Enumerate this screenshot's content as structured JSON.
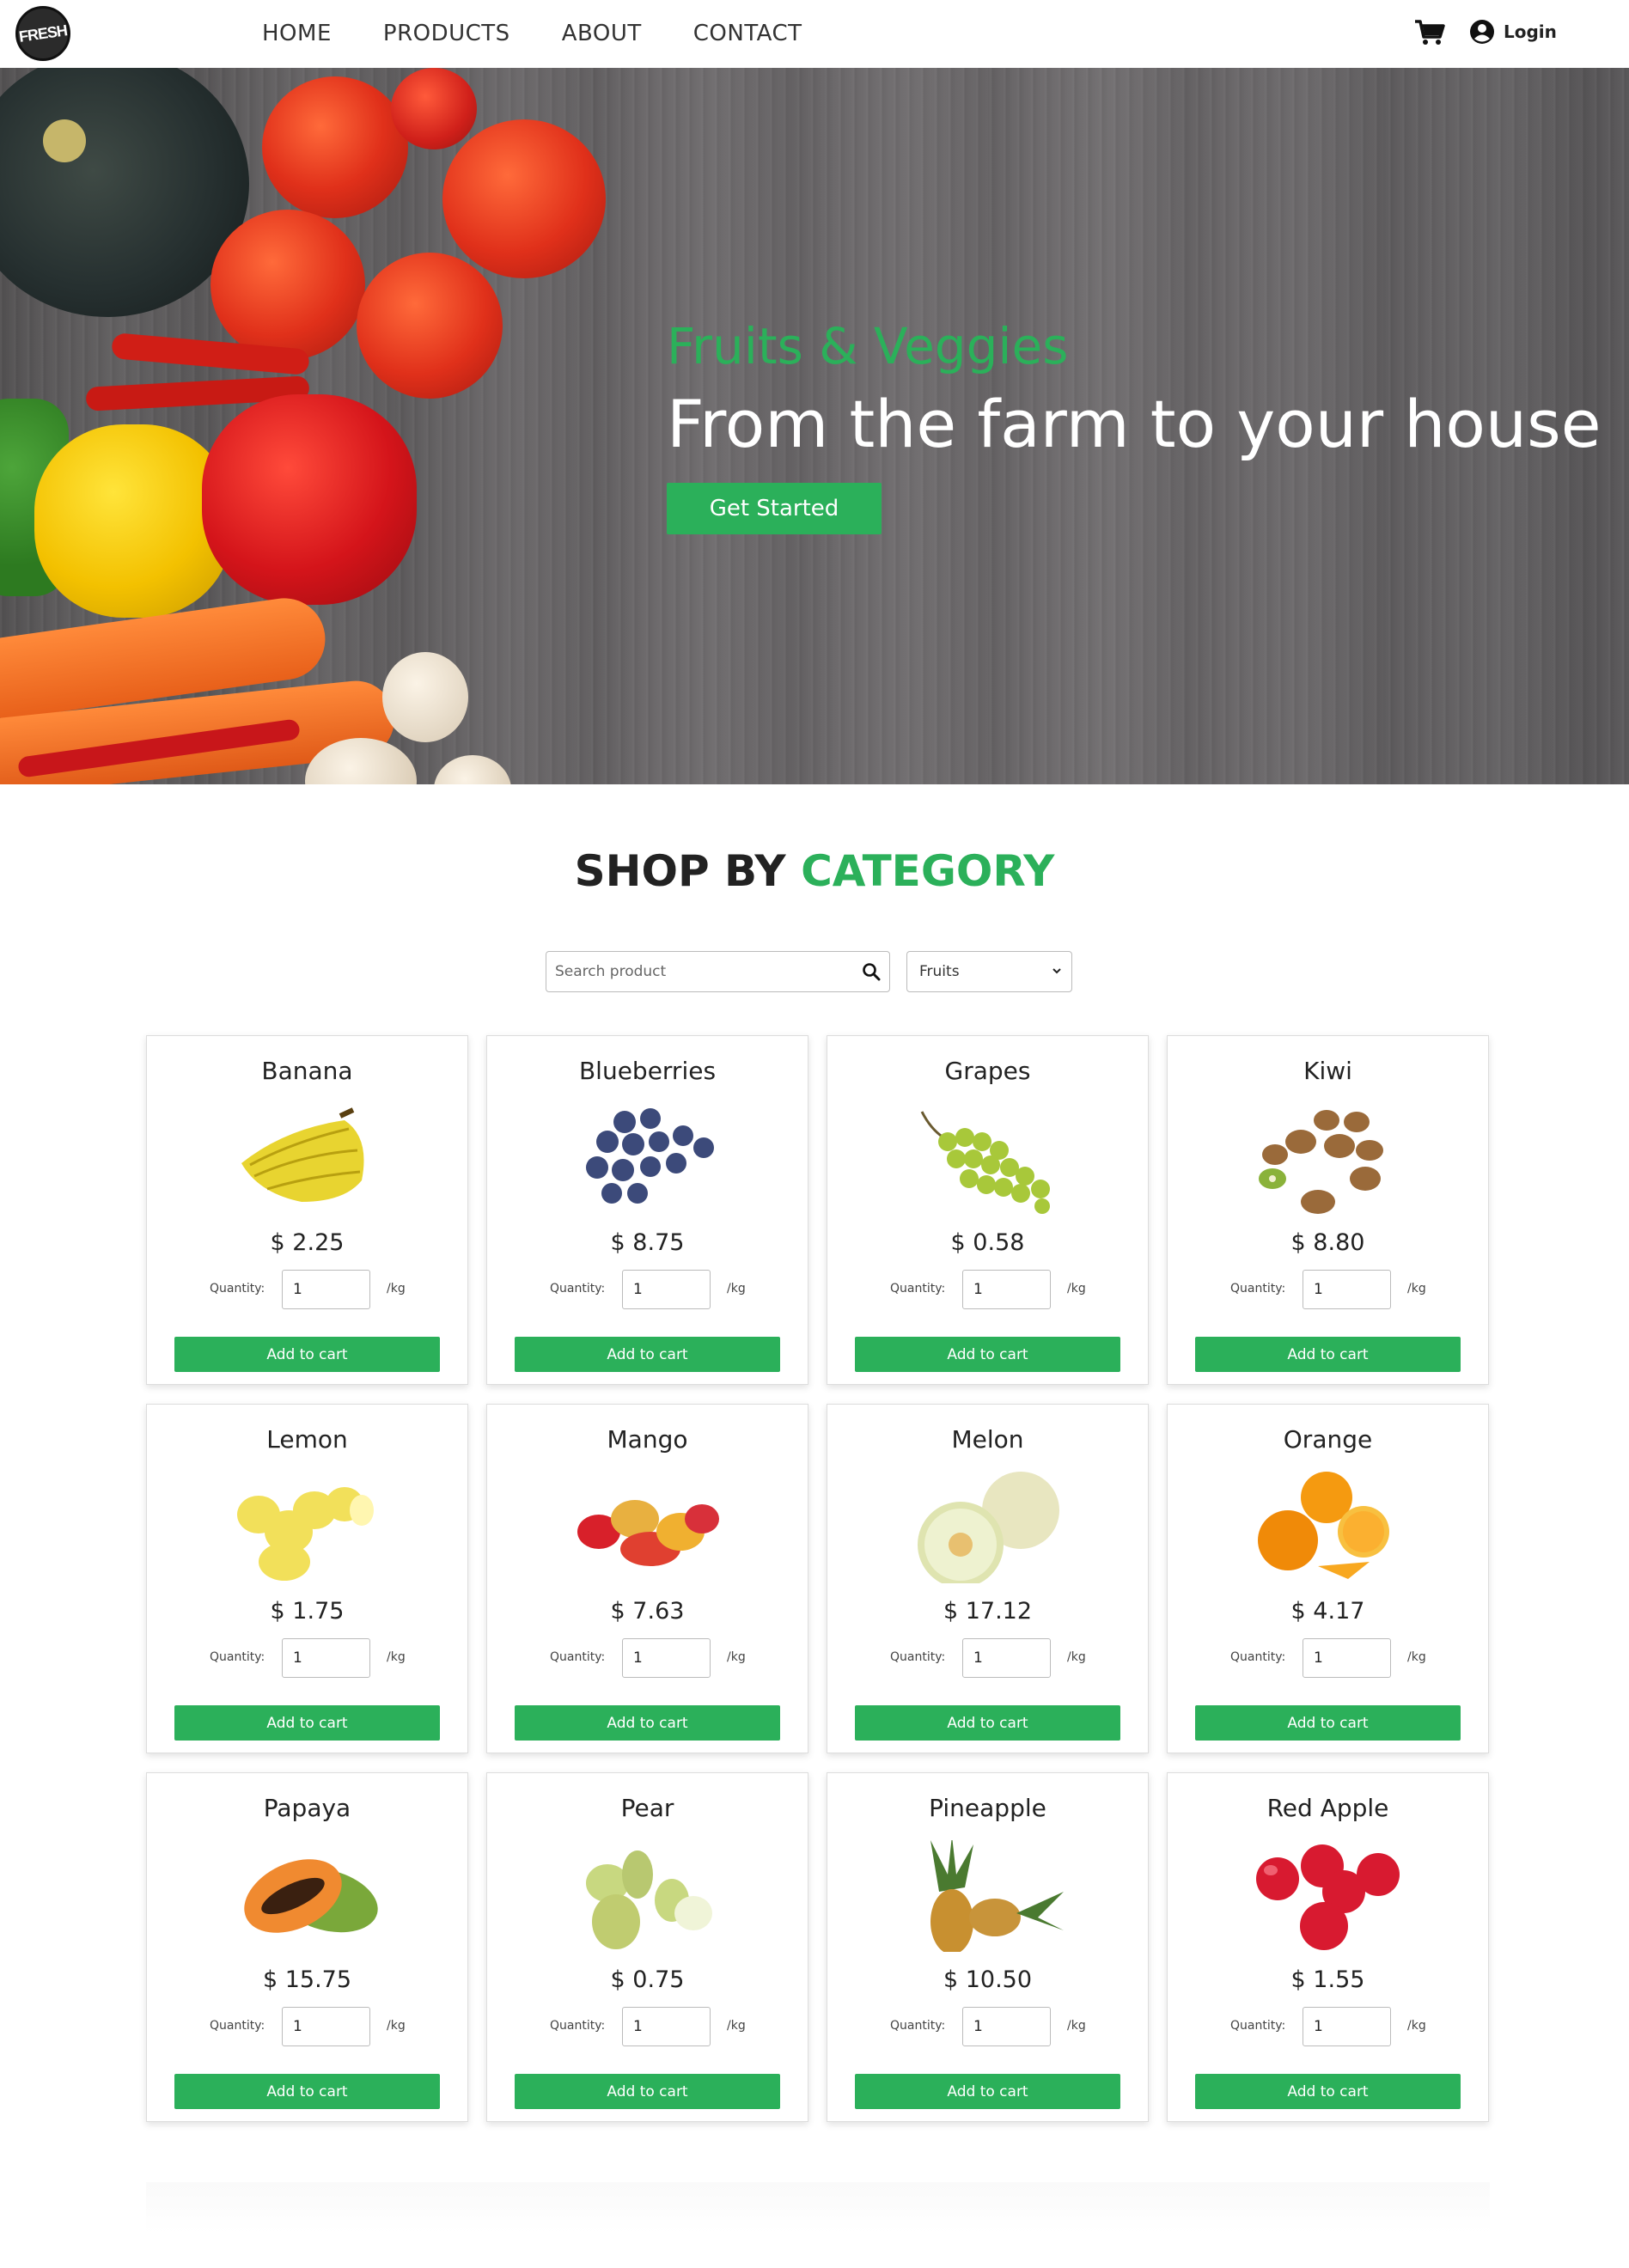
{
  "nav": {
    "logo_text": "FRESH",
    "links": [
      "HOME",
      "PRODUCTS",
      "ABOUT",
      "CONTACT"
    ],
    "login_label": "Login",
    "icons": {
      "cart": "cart-icon",
      "user": "user-circle-icon"
    }
  },
  "hero": {
    "subtitle": "Fruits & Veggies",
    "title": "From the farm to your house",
    "button": "Get Started"
  },
  "section": {
    "title_main": "SHOP BY",
    "title_accent": "CATEGORY"
  },
  "search": {
    "placeholder": "Search product",
    "icon": "search-icon"
  },
  "category_select": {
    "selected": "Fruits"
  },
  "colors": {
    "accent": "#2bb05a",
    "text": "#222222"
  },
  "product_labels": {
    "quantity": "Quantity:",
    "unit": "/kg",
    "add_to_cart": "Add to cart",
    "default_qty": "1"
  },
  "products": [
    {
      "name": "Banana",
      "price": "$ 2.25"
    },
    {
      "name": "Blueberries",
      "price": "$ 8.75"
    },
    {
      "name": "Grapes",
      "price": "$ 0.58"
    },
    {
      "name": "Kiwi",
      "price": "$ 8.80"
    },
    {
      "name": "Lemon",
      "price": "$ 1.75"
    },
    {
      "name": "Mango",
      "price": "$ 7.63"
    },
    {
      "name": "Melon",
      "price": "$ 17.12"
    },
    {
      "name": "Orange",
      "price": "$ 4.17"
    },
    {
      "name": "Papaya",
      "price": "$ 15.75"
    },
    {
      "name": "Pear",
      "price": "$ 0.75"
    },
    {
      "name": "Pineapple",
      "price": "$ 10.50"
    },
    {
      "name": "Red Apple",
      "price": "$ 1.55"
    }
  ]
}
